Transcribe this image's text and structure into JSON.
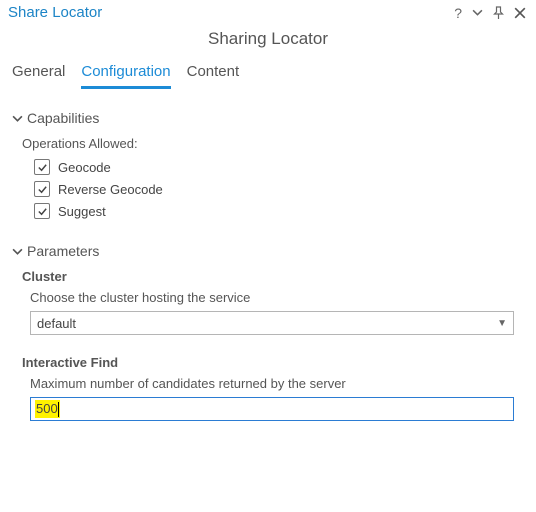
{
  "titlebar": {
    "title": "Share Locator"
  },
  "subtitle": "Sharing Locator",
  "tabs": [
    {
      "label": "General",
      "active": false
    },
    {
      "label": "Configuration",
      "active": true
    },
    {
      "label": "Content",
      "active": false
    }
  ],
  "capabilities": {
    "header": "Capabilities",
    "operations_label": "Operations Allowed:",
    "items": [
      {
        "label": "Geocode",
        "checked": true
      },
      {
        "label": "Reverse Geocode",
        "checked": true
      },
      {
        "label": "Suggest",
        "checked": true
      }
    ]
  },
  "parameters": {
    "header": "Parameters",
    "cluster": {
      "heading": "Cluster",
      "description": "Choose the cluster hosting the service",
      "value": "default"
    },
    "interactive_find": {
      "heading": "Interactive Find",
      "description": "Maximum number of candidates returned by the server",
      "value": "500"
    }
  }
}
